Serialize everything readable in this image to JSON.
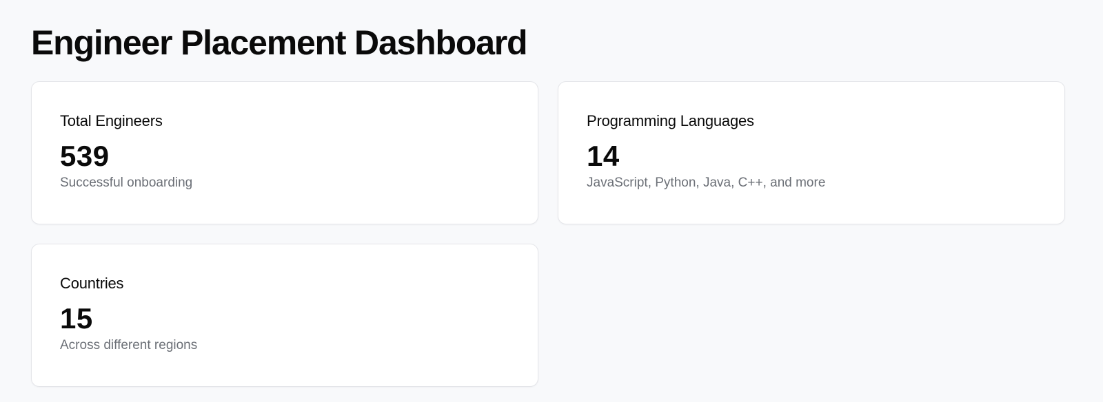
{
  "page": {
    "title": "Engineer Placement Dashboard"
  },
  "cards": [
    {
      "title": "Total Engineers",
      "value": "539",
      "description": "Successful onboarding"
    },
    {
      "title": "Programming Languages",
      "value": "14",
      "description": "JavaScript, Python, Java, C++, and more"
    },
    {
      "title": "Countries",
      "value": "15",
      "description": "Across different regions"
    }
  ],
  "colors": {
    "background": "#f8f9fb",
    "card_background": "#ffffff",
    "card_border": "#e4e5e9",
    "text_primary": "#0a0a0a",
    "text_secondary": "#6b6f76"
  }
}
